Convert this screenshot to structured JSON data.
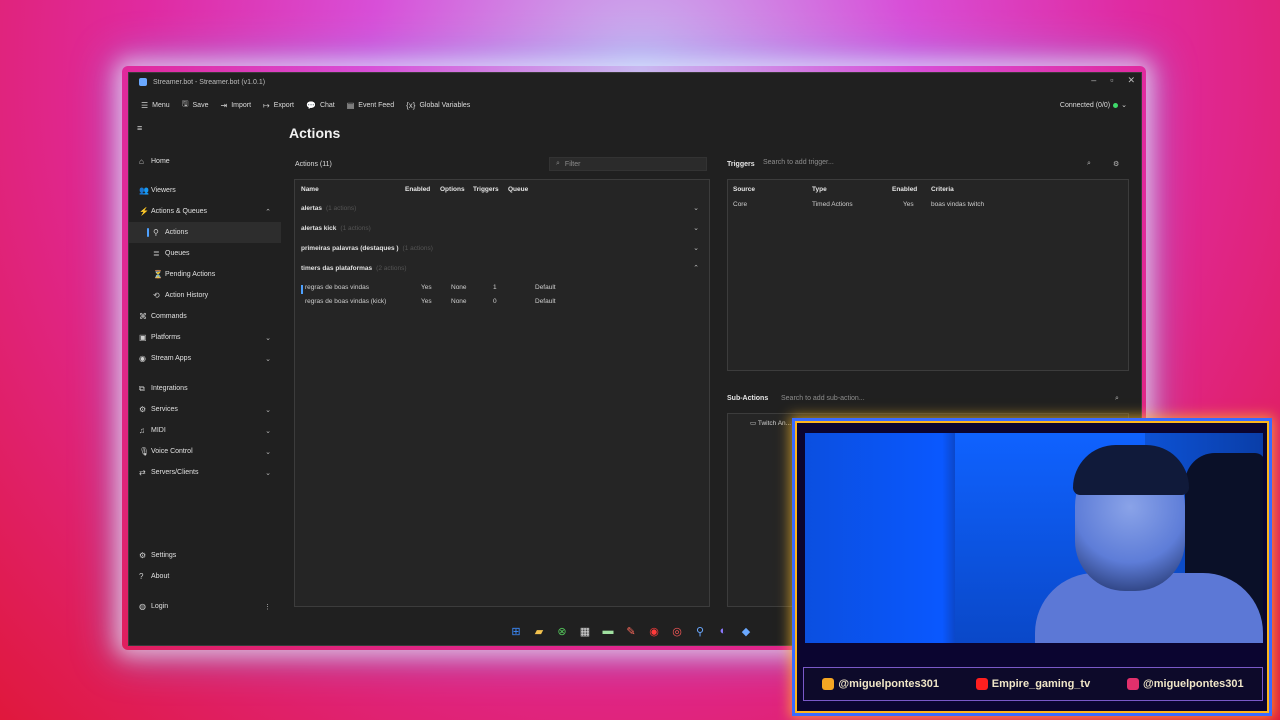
{
  "window": {
    "title": "Streamer.bot - Streamer.bot (v1.0.1)"
  },
  "menubar": [
    {
      "icon": "☰",
      "label": "Menu"
    },
    {
      "icon": "🖫",
      "label": "Save"
    },
    {
      "icon": "⇥",
      "label": "Import"
    },
    {
      "icon": "↦",
      "label": "Export"
    },
    {
      "icon": "💬",
      "label": "Chat"
    },
    {
      "icon": "▤",
      "label": "Event Feed"
    },
    {
      "icon": "{x}",
      "label": "Global Variables"
    }
  ],
  "connection": {
    "label": "Connected (0/0)",
    "status_color": "#3ed96a"
  },
  "page_title": "Actions",
  "sidebar": {
    "items": [
      {
        "icon": "⌂",
        "label": "Home"
      },
      {
        "icon": "👥",
        "label": "Viewers"
      },
      {
        "icon": "⚡",
        "label": "Actions & Queues"
      },
      {
        "icon": "⚲",
        "label": "Actions"
      },
      {
        "icon": "≣",
        "label": "Queues"
      },
      {
        "icon": "⏳",
        "label": "Pending Actions"
      },
      {
        "icon": "⟲",
        "label": "Action History"
      },
      {
        "icon": "⌘",
        "label": "Commands"
      },
      {
        "icon": "▣",
        "label": "Platforms"
      },
      {
        "icon": "◉",
        "label": "Stream Apps"
      },
      {
        "icon": "⧉",
        "label": "Integrations"
      },
      {
        "icon": "⚙",
        "label": "Services"
      },
      {
        "icon": "♫",
        "label": "MIDI"
      },
      {
        "icon": "🎙",
        "label": "Voice Control"
      },
      {
        "icon": "⇄",
        "label": "Servers/Clients"
      }
    ],
    "bottom": [
      {
        "icon": "⚙",
        "label": "Settings"
      },
      {
        "icon": "?",
        "label": "About"
      },
      {
        "icon": "◍",
        "label": "Login"
      }
    ]
  },
  "actions": {
    "header": "Actions (11)",
    "filter_placeholder": "Filter",
    "columns": [
      "Name",
      "Enabled",
      "Options",
      "Triggers",
      "Queue"
    ],
    "groups": [
      {
        "name": "alertas",
        "count": "(1 actions)"
      },
      {
        "name": "alertas kick",
        "count": "(1 actions)"
      },
      {
        "name": "primeiras palavras (destaques )",
        "count": "(1 actions)"
      },
      {
        "name": "timers das plataformas",
        "count": "(2 actions)"
      }
    ],
    "rows": [
      {
        "name": "regras de boas vindas",
        "enabled": "Yes",
        "options": "None",
        "triggers": "1",
        "queue": "Default"
      },
      {
        "name": "regras de boas vindas (kick)",
        "enabled": "Yes",
        "options": "None",
        "triggers": "0",
        "queue": "Default"
      }
    ]
  },
  "triggers": {
    "title": "Triggers",
    "search_placeholder": "Search to add trigger...",
    "columns": [
      "Source",
      "Type",
      "Enabled",
      "Criteria"
    ],
    "rows": [
      {
        "source": "Core",
        "type": "Timed Actions",
        "enabled": "Yes",
        "criteria": "boas vindas twitch"
      }
    ]
  },
  "subactions": {
    "title": "Sub-Actions",
    "search_placeholder": "Search to add sub-action...",
    "first_item": "Twitch An..."
  },
  "overlay": {
    "socials": [
      {
        "handle": "@miguelpontes301",
        "color": "#f5a623"
      },
      {
        "handle": "Empire_gaming_tv",
        "color": "#ff1f1f"
      },
      {
        "handle": "@miguelpontes301",
        "color": "#e1306c"
      }
    ]
  }
}
